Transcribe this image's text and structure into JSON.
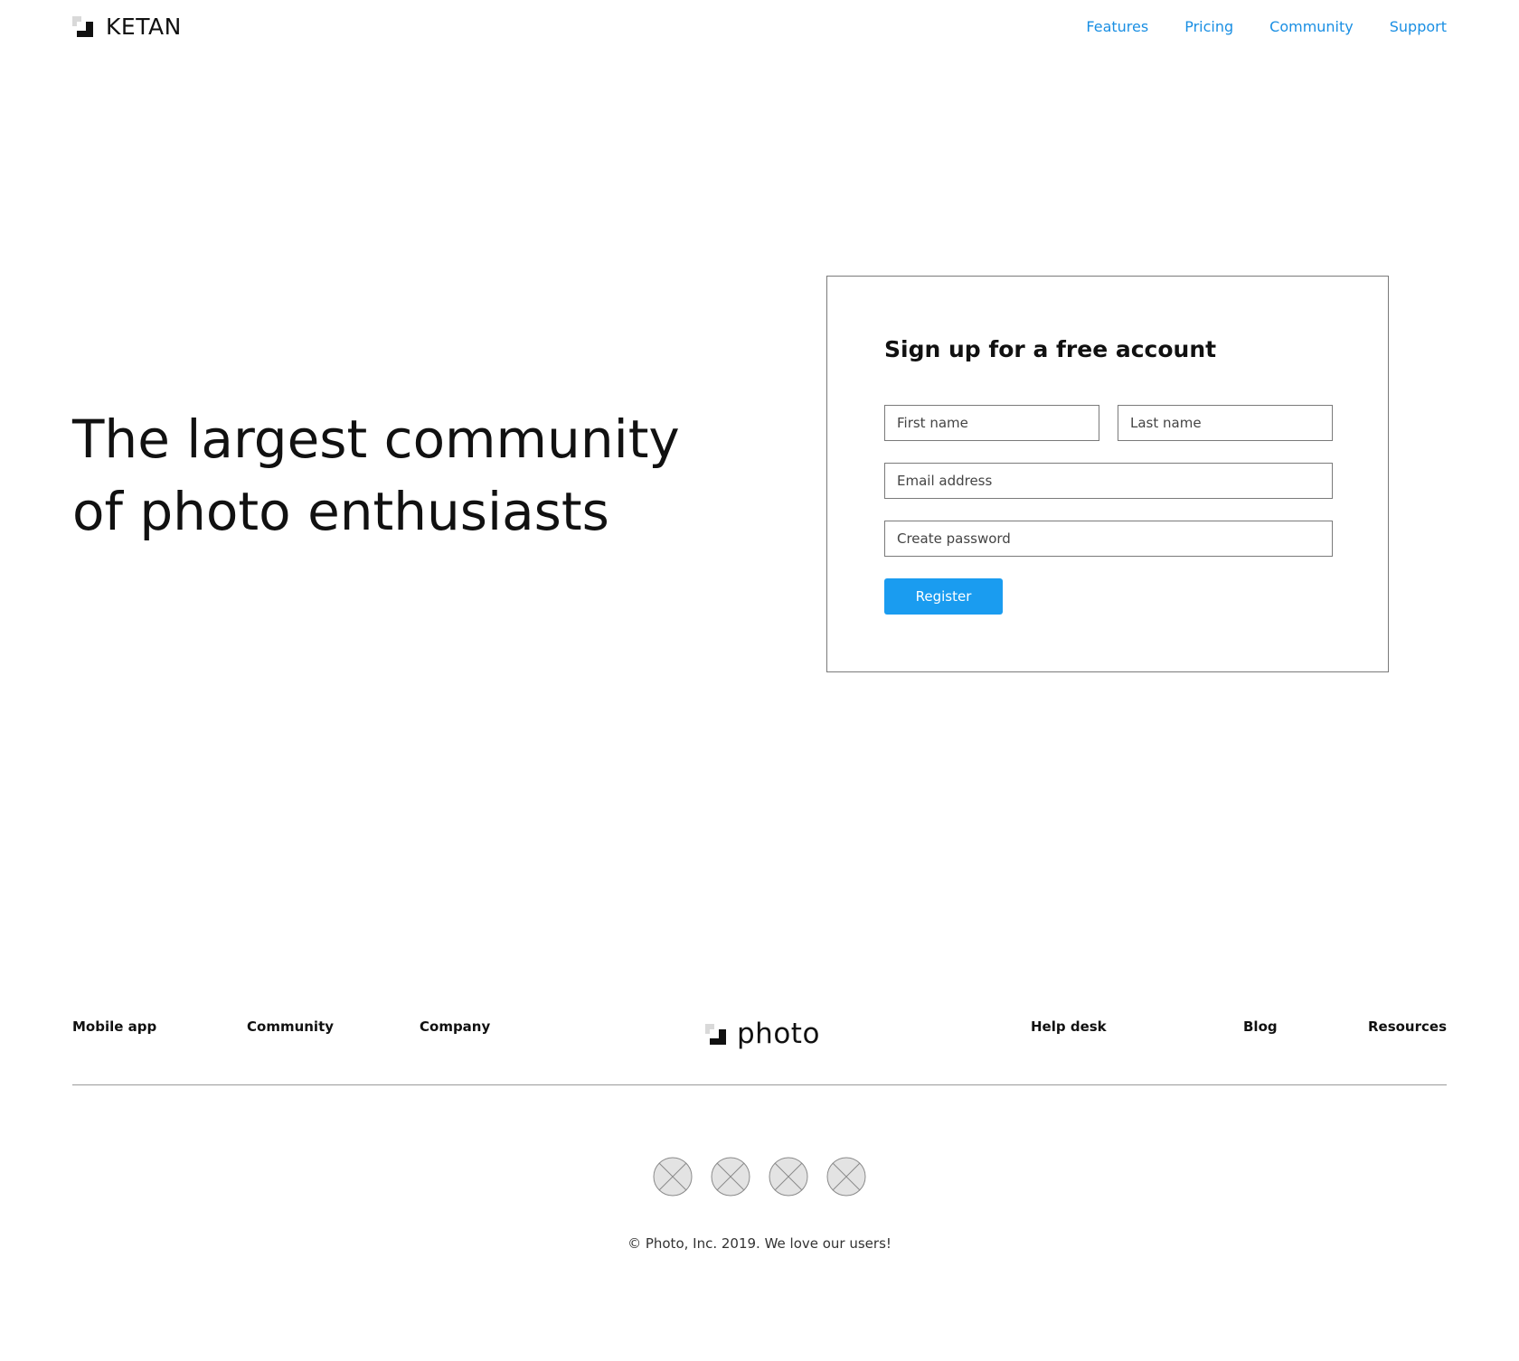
{
  "header": {
    "brand": "KETAN",
    "nav": [
      "Features",
      "Pricing",
      "Community",
      "Support"
    ]
  },
  "hero": {
    "title_line1": "The largest community",
    "title_line2": "of photo enthusiasts"
  },
  "signup": {
    "title": "Sign up for a free account",
    "first_name_placeholder": "First name",
    "last_name_placeholder": "Last name",
    "email_placeholder": "Email address",
    "password_placeholder": "Create password",
    "register_label": "Register"
  },
  "footer": {
    "links_left": [
      "Mobile app",
      "Community",
      "Company"
    ],
    "brand": "photo",
    "links_right": [
      "Help desk",
      "Blog",
      "Resources"
    ],
    "social_icons": [
      "placeholder-image-icon",
      "placeholder-image-icon",
      "placeholder-image-icon",
      "placeholder-image-icon"
    ],
    "copyright": "© Photo, Inc. 2019. We love our users!"
  },
  "colors": {
    "link": "#1a8fe3",
    "button": "#1a9cf0",
    "border": "#7a7a7a"
  }
}
